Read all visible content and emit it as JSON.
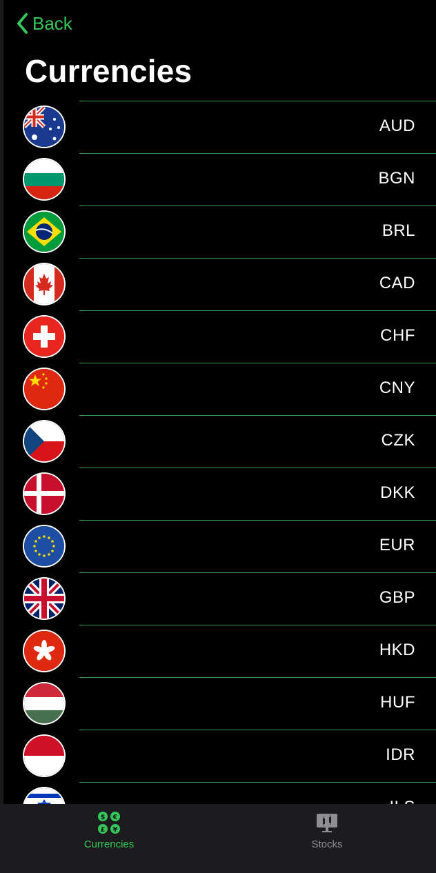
{
  "nav": {
    "back_label": "Back",
    "title": "Currencies"
  },
  "accent_color": "#34c759",
  "currencies": [
    {
      "code": "AUD",
      "flag": "australia-flag"
    },
    {
      "code": "BGN",
      "flag": "bulgaria-flag"
    },
    {
      "code": "BRL",
      "flag": "brazil-flag"
    },
    {
      "code": "CAD",
      "flag": "canada-flag"
    },
    {
      "code": "CHF",
      "flag": "switzerland-flag"
    },
    {
      "code": "CNY",
      "flag": "china-flag"
    },
    {
      "code": "CZK",
      "flag": "czech-flag"
    },
    {
      "code": "DKK",
      "flag": "denmark-flag"
    },
    {
      "code": "EUR",
      "flag": "eu-flag"
    },
    {
      "code": "GBP",
      "flag": "uk-flag"
    },
    {
      "code": "HKD",
      "flag": "hong-kong-flag"
    },
    {
      "code": "HUF",
      "flag": "hungary-flag"
    },
    {
      "code": "IDR",
      "flag": "indonesia-flag"
    },
    {
      "code": "ILS",
      "flag": "israel-flag"
    }
  ],
  "tabbar": {
    "tabs": [
      {
        "label": "Currencies",
        "icon": "currency-exchange-icon",
        "active": true
      },
      {
        "label": "Stocks",
        "icon": "stock-chart-icon",
        "active": false
      }
    ]
  }
}
